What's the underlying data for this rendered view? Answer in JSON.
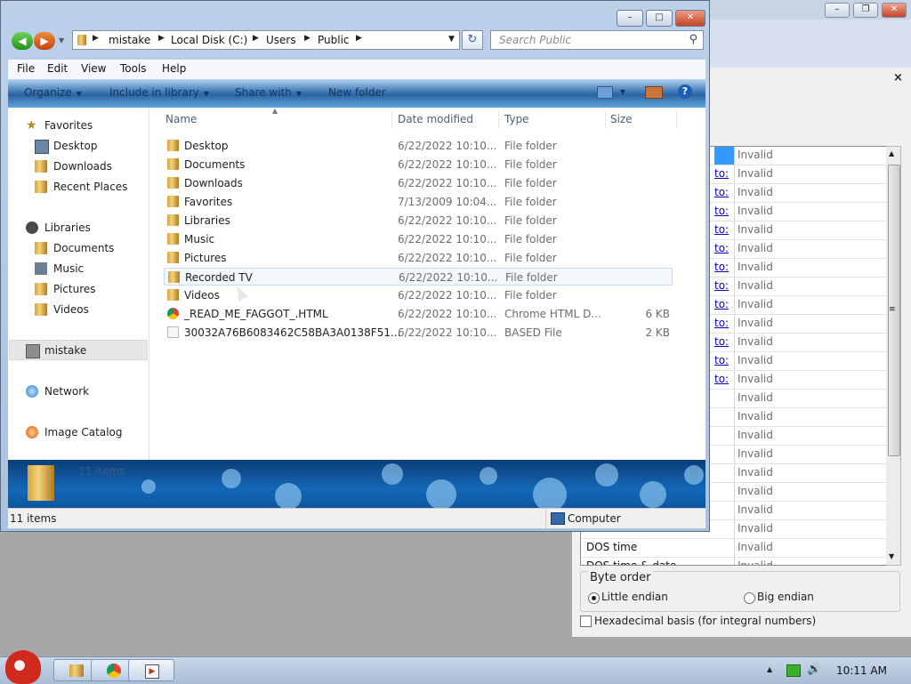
{
  "explorer": {
    "address": [
      "mistake",
      "Local Disk (C:)",
      "Users",
      "Public"
    ],
    "search_placeholder": "Search Public",
    "menu": [
      "File",
      "Edit",
      "View",
      "Tools",
      "Help"
    ],
    "toolbar": [
      "Organize",
      "Include in library",
      "Share with",
      "New folder"
    ],
    "nav": {
      "favorites": "Favorites",
      "favorites_items": [
        "Desktop",
        "Downloads",
        "Recent Places"
      ],
      "libraries": "Libraries",
      "libraries_items": [
        "Documents",
        "Music",
        "Pictures",
        "Videos"
      ],
      "computer": "mistake",
      "network": "Network",
      "image_catalog": "Image Catalog"
    },
    "columns": [
      "Name",
      "Date modified",
      "Type",
      "Size"
    ],
    "files": [
      {
        "name": "Desktop",
        "date": "6/22/2022 10:10...",
        "type": "File folder",
        "size": ""
      },
      {
        "name": "Documents",
        "date": "6/22/2022 10:10...",
        "type": "File folder",
        "size": ""
      },
      {
        "name": "Downloads",
        "date": "6/22/2022 10:10...",
        "type": "File folder",
        "size": ""
      },
      {
        "name": "Favorites",
        "date": "7/13/2009 10:04...",
        "type": "File folder",
        "size": ""
      },
      {
        "name": "Libraries",
        "date": "6/22/2022 10:10...",
        "type": "File folder",
        "size": ""
      },
      {
        "name": "Music",
        "date": "6/22/2022 10:10...",
        "type": "File folder",
        "size": ""
      },
      {
        "name": "Pictures",
        "date": "6/22/2022 10:10...",
        "type": "File folder",
        "size": ""
      },
      {
        "name": "Recorded TV",
        "date": "6/22/2022 10:10...",
        "type": "File folder",
        "size": ""
      },
      {
        "name": "Videos",
        "date": "6/22/2022 10:10...",
        "type": "File folder",
        "size": ""
      },
      {
        "name": "_READ_ME_FAGGOT_.HTML",
        "date": "6/22/2022 10:10...",
        "type": "Chrome HTML D...",
        "size": "6 KB"
      },
      {
        "name": "30032A76B6083462C58BA3A0138F51...",
        "date": "6/22/2022 10:10...",
        "type": "BASED File",
        "size": "2 KB"
      }
    ],
    "details_count": "11 items",
    "status_count": "11 items",
    "status_location": "Computer"
  },
  "inspector": {
    "invalid": "Invalid",
    "link": "to:",
    "dos_time": "DOS time",
    "dos_time_partial": "DOS time & date",
    "byte_order": "Byte order",
    "little_endian": "Little endian",
    "big_endian": "Big endian",
    "hex_basis": "Hexadecimal basis (for integral numbers)"
  },
  "taskbar": {
    "clock": "10:11 AM"
  },
  "colors": {
    "accent": "#3399ff",
    "toolbar": "#2c63a2",
    "link": "#0000cc"
  }
}
